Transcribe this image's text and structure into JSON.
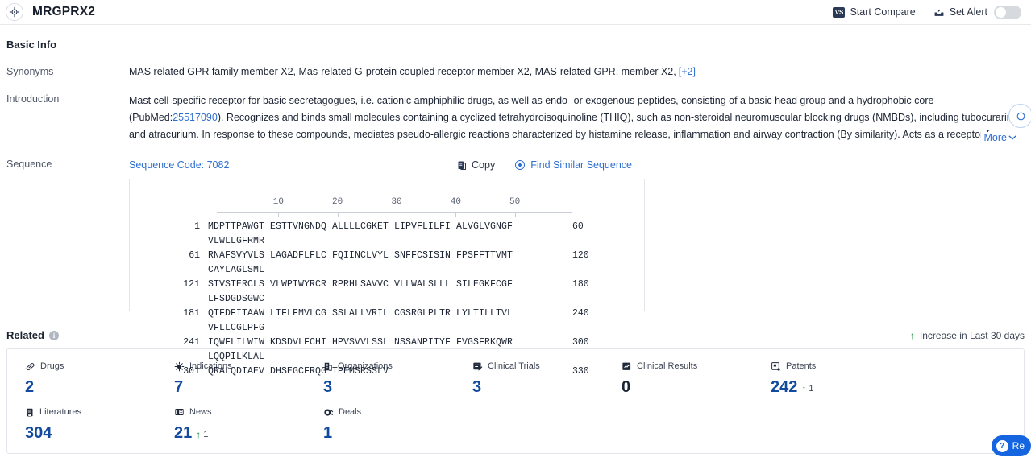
{
  "header": {
    "gene_icon": "target-icon",
    "title": "MRGPRX2",
    "start_compare_label": "Start Compare",
    "compare_badge": "VS",
    "set_alert_label": "Set Alert",
    "alert_toggle_state": "off"
  },
  "basic_info": {
    "title": "Basic Info",
    "synonyms_label": "Synonyms",
    "synonyms_text": "MAS related GPR family member X2,  Mas-related G-protein coupled receptor member X2,  MAS-related GPR, member X2,",
    "synonyms_more": "[+2]",
    "introduction_label": "Introduction",
    "introduction_part1": "Mast cell-specific receptor for basic secretagogues, i.e. cationic amphiphilic drugs, as well as endo- or exogenous peptides, consisting of a basic head group and a hydrophobic core (PubMed:",
    "introduction_pubmed": "25517090",
    "introduction_part2": "). Recognizes and binds small molecules containing a cyclized tetrahydroisoquinoline (THIQ), such as non-steroidal neuromuscular blocking drugs (NMBDs), including tubocurarine and atracurium. In response to these compounds, mediates pseudo-allergic reactions characterized by histamine release, inflammation and airway contraction (By similarity). Acts as a receptor for a number of other ligands, including peptides and alkaloids, such as cortistatin-14, proadrenomedullin N-terminal peptides and others.",
    "more_label": "More"
  },
  "sequence": {
    "label": "Sequence",
    "code_label": "Sequence Code: 7082",
    "copy_label": "Copy",
    "find_similar_label": "Find Similar Sequence",
    "ruler_ticks": [
      10,
      20,
      30,
      40,
      50
    ],
    "rows": [
      {
        "start": "1",
        "blocks": "MDPTTPAWGT ESTTVNGNDQ ALLLLCGKET LIPVFLILFI ALVGLVGNGF VLWLLGFRMR",
        "end": "60"
      },
      {
        "start": "61",
        "blocks": "RNAFSVYVLS LAGADFLFLC FQIINCLVYL SNFFCSISIN FPSFFTTVMT CAYLAGLSML",
        "end": "120"
      },
      {
        "start": "121",
        "blocks": "STVSTERCLS VLWPIWYRCR RPRHLSAVVC VLLWALSLLL SILEGKFCGF LFSDGDSGWC",
        "end": "180"
      },
      {
        "start": "181",
        "blocks": "QTFDFITAAW LIFLFMVLCG SSLALLVRIL CGSRGLPLTR LYLTILLTVL VFLLCGLPFG",
        "end": "240"
      },
      {
        "start": "241",
        "blocks": "IQWFLILWIW KDSDVLFCHI HPVSVVLSSL NSSANPIIYF FVGSFRKQWR LQQPILKLAL",
        "end": "300"
      },
      {
        "start": "301",
        "blocks": "QRALQDIAEV DHSEGCFRQG TPEMSRSSLV",
        "end": "330"
      }
    ]
  },
  "related": {
    "title": "Related",
    "increase_note": "Increase in Last 30 days",
    "stats": [
      {
        "label": "Drugs",
        "icon": "capsule-icon",
        "value": "2",
        "delta": "",
        "link": true
      },
      {
        "label": "Indications",
        "icon": "virus-icon",
        "value": "7",
        "delta": "",
        "link": true
      },
      {
        "label": "Organizations",
        "icon": "building-icon",
        "value": "3",
        "delta": "",
        "link": true
      },
      {
        "label": "Clinical Trials",
        "icon": "clipboard-icon",
        "value": "3",
        "delta": "",
        "link": true
      },
      {
        "label": "Clinical Results",
        "icon": "results-chart-icon",
        "value": "0",
        "delta": "",
        "link": false
      },
      {
        "label": "Patents",
        "icon": "patent-icon",
        "value": "242",
        "delta": "1",
        "link": true
      },
      {
        "label": "Literatures",
        "icon": "book-icon",
        "value": "304",
        "delta": "",
        "link": true
      },
      {
        "label": "News",
        "icon": "news-icon",
        "value": "21",
        "delta": "1",
        "link": true
      },
      {
        "label": "Deals",
        "icon": "handshake-icon",
        "value": "1",
        "delta": "",
        "link": true
      }
    ]
  },
  "help": {
    "label": "Re",
    "badge": "?"
  }
}
